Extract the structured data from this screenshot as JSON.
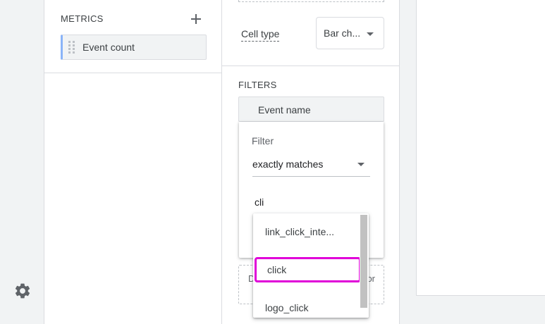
{
  "metrics": {
    "heading": "METRICS",
    "items": [
      {
        "label": "Event count"
      }
    ]
  },
  "tab_settings": {
    "cell_type_label": "Cell type",
    "cell_type_value": "Bar ch...",
    "filters_heading": "FILTERS",
    "filter_dimension": "Event name"
  },
  "filter_panel": {
    "label": "Filter",
    "match_type": "exactly matches",
    "input_value": "cli"
  },
  "drop_zone": {
    "left_text": "D",
    "right_text": "or"
  },
  "suggestions": {
    "items": [
      {
        "label": "link_click_inte..."
      },
      {
        "label": "click"
      },
      {
        "label": "logo_click"
      }
    ],
    "highlight_color": "#e000d8"
  },
  "colors": {
    "accent": "#8ab4f8"
  }
}
